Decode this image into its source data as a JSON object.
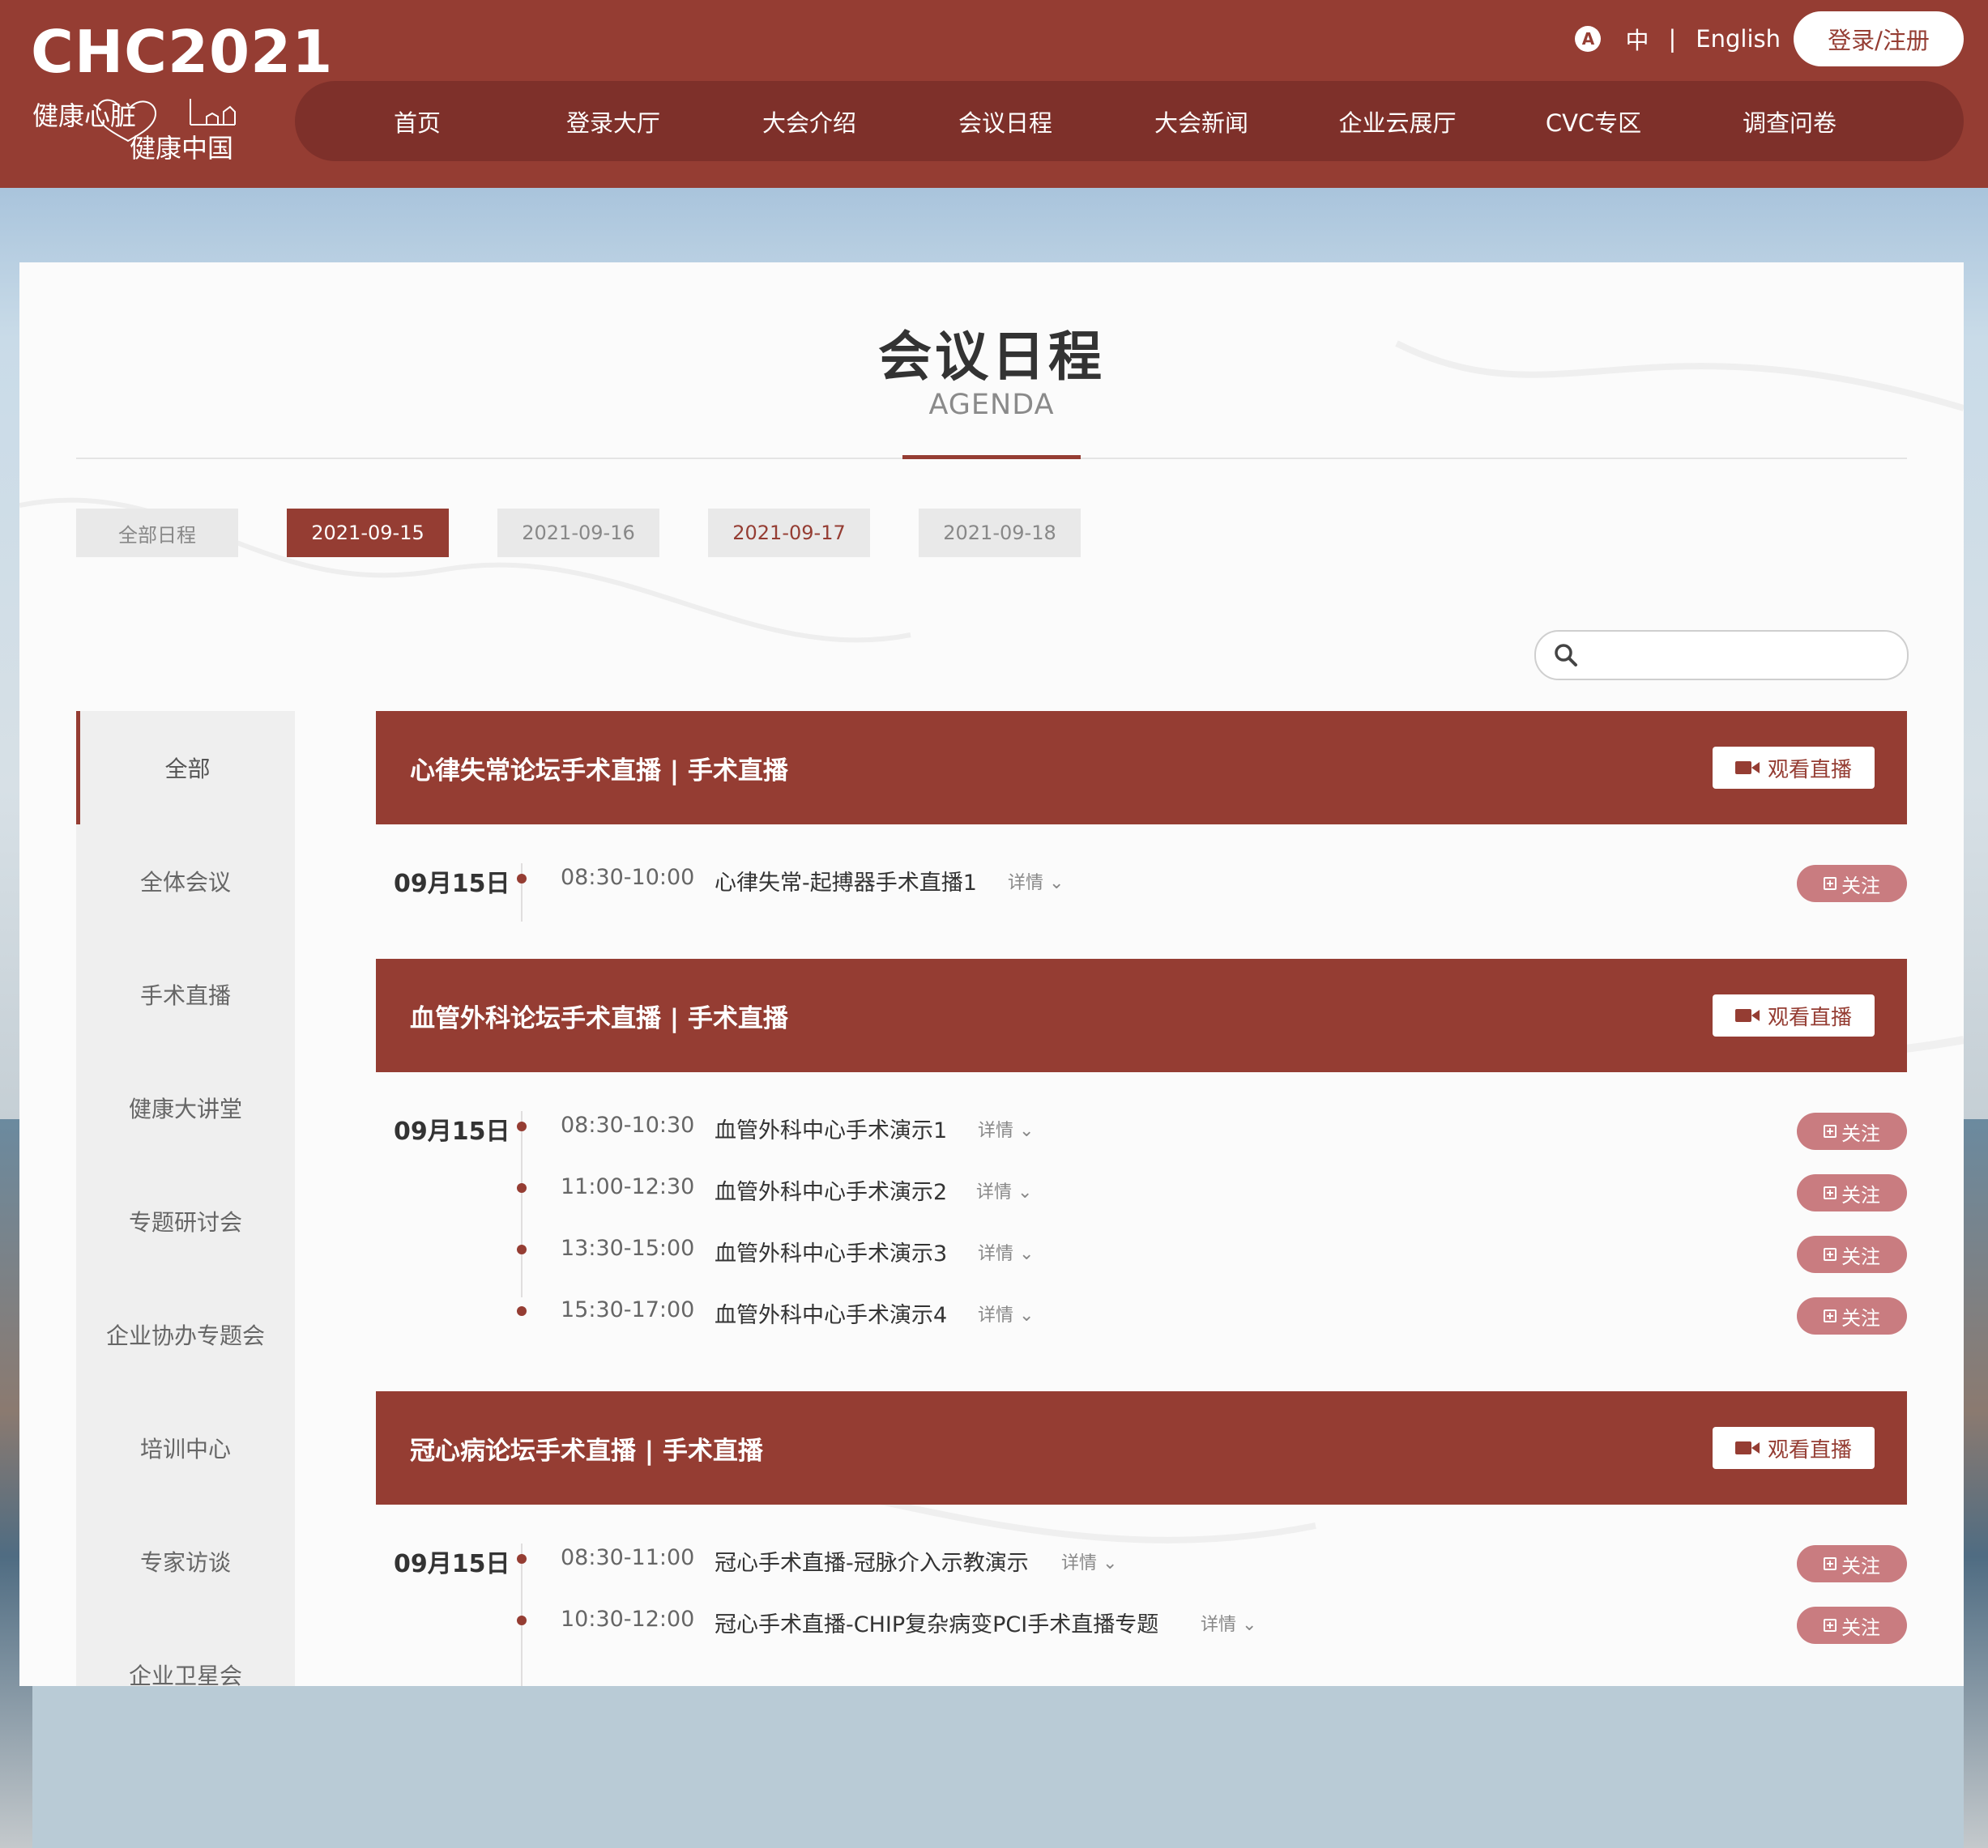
{
  "header": {
    "logo_text": "CHC2021",
    "logo_line1": "健康心脏",
    "logo_line2": "健康中国",
    "lang_icon": "A",
    "lang_zh": "中",
    "lang_sep": "|",
    "lang_en": "English",
    "login": "登录/注册",
    "nav": [
      "首页",
      "登录大厅",
      "大会介绍",
      "会议日程",
      "大会新闻",
      "企业云展厅",
      "CVC专区",
      "调查问卷"
    ]
  },
  "page": {
    "title": "会议日程",
    "subtitle": "AGENDA"
  },
  "date_tabs": [
    "全部日程",
    "2021-09-15",
    "2021-09-16",
    "2021-09-17",
    "2021-09-18"
  ],
  "active_date": "2021-09-15",
  "search": {
    "placeholder": ""
  },
  "sidebar": [
    "全部",
    "全体会议",
    "手术直播",
    "健康大讲堂",
    "专题研讨会",
    "企业协办专题会",
    "培训中心",
    "专家访谈",
    "企业卫星会"
  ],
  "sessions": [
    {
      "title": "心律失常论坛手术直播 | 手术直播",
      "watch": "观看直播",
      "day": "09月15日",
      "items": [
        {
          "time": "08:30-10:00",
          "title": "心律失常-起搏器手术直播1",
          "detail": "详情",
          "follow": "关注"
        }
      ]
    },
    {
      "title": "血管外科论坛手术直播 | 手术直播",
      "watch": "观看直播",
      "day": "09月15日",
      "items": [
        {
          "time": "08:30-10:30",
          "title": "血管外科中心手术演示1",
          "detail": "详情",
          "follow": "关注"
        },
        {
          "time": "11:00-12:30",
          "title": "血管外科中心手术演示2",
          "detail": "详情",
          "follow": "关注"
        },
        {
          "time": "13:30-15:00",
          "title": "血管外科中心手术演示3",
          "detail": "详情",
          "follow": "关注"
        },
        {
          "time": "15:30-17:00",
          "title": "血管外科中心手术演示4",
          "detail": "详情",
          "follow": "关注"
        }
      ]
    },
    {
      "title": "冠心病论坛手术直播 | 手术直播",
      "watch": "观看直播",
      "day": "09月15日",
      "items": [
        {
          "time": "08:30-11:00",
          "title": "冠心手术直播-冠脉介入示教演示",
          "detail": "详情",
          "follow": "关注"
        },
        {
          "time": "10:30-12:00",
          "title": "冠心手术直播-CHIP复杂病变PCI手术直播专题",
          "detail": "详情",
          "follow": "关注"
        }
      ]
    }
  ],
  "colors": {
    "brand": "#953d33",
    "nav_bg": "#7e302a",
    "follow": "#c97c80"
  }
}
